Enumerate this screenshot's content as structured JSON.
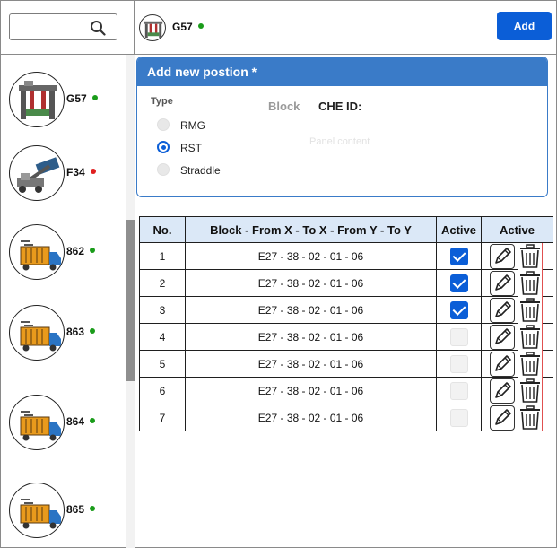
{
  "search": {
    "value": "",
    "placeholder": ""
  },
  "header": {
    "machine_name": "G57",
    "machine_status_color": "#1a9c1a",
    "add_label": "Add"
  },
  "machines": [
    {
      "name": "G57",
      "status_color": "#1a9c1a",
      "icon": "gantry-crane-icon"
    },
    {
      "name": "F34",
      "status_color": "#e02020",
      "icon": "reach-stacker-icon"
    },
    {
      "name": "862",
      "status_color": "#1a9c1a",
      "icon": "truck-icon"
    },
    {
      "name": "863",
      "status_color": "#1a9c1a",
      "icon": "truck-icon"
    },
    {
      "name": "864",
      "status_color": "#1a9c1a",
      "icon": "truck-icon"
    },
    {
      "name": "865",
      "status_color": "#1a9c1a",
      "icon": "truck-icon"
    }
  ],
  "panel": {
    "title": "Add new postion *",
    "type_label": "Type",
    "options": [
      {
        "label": "RMG",
        "checked": false
      },
      {
        "label": "RST",
        "checked": true
      },
      {
        "label": "Straddle",
        "checked": false
      }
    ],
    "block_label": "Block",
    "che_label": "CHE ID:",
    "content_placeholder": "Panel content"
  },
  "table": {
    "headers": [
      "No.",
      "Block - From X - To X - From Y - To Y",
      "Active",
      "Active"
    ],
    "rows": [
      {
        "no": "1",
        "block": "E27 - 38 - 02 - 01 - 06",
        "active": true
      },
      {
        "no": "2",
        "block": "E27 - 38 - 02 - 01 - 06",
        "active": true
      },
      {
        "no": "3",
        "block": "E27 - 38 - 02 - 01 - 06",
        "active": true
      },
      {
        "no": "4",
        "block": "E27 - 38 - 02 - 01 - 06",
        "active": false
      },
      {
        "no": "5",
        "block": "E27 - 38 - 02 - 01 - 06",
        "active": false
      },
      {
        "no": "6",
        "block": "E27 - 38 - 02 - 01 - 06",
        "active": false
      },
      {
        "no": "7",
        "block": "E27 - 38 - 02 - 01 - 06",
        "active": false
      }
    ]
  },
  "colors": {
    "accent": "#0b5ed7",
    "panel_header": "#3a7bc8",
    "table_header": "#dbe8f7"
  }
}
